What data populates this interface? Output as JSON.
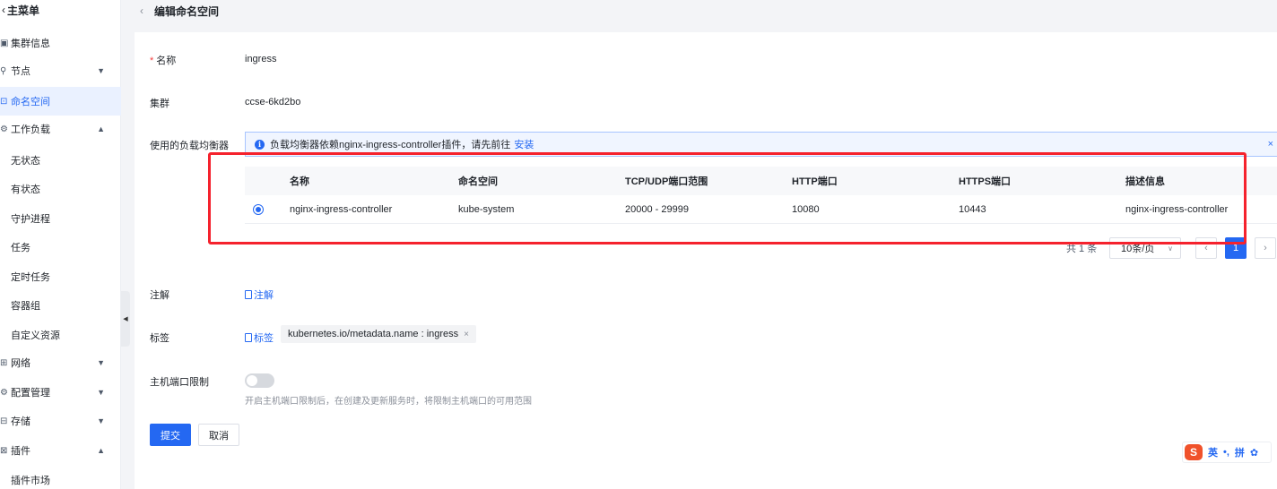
{
  "sidebar": {
    "back_label": "主菜单",
    "items": [
      {
        "label": "集群信息",
        "icon": "cluster-icon"
      },
      {
        "label": "节点",
        "icon": "node-icon",
        "chevron": "▼"
      },
      {
        "label": "命名空间",
        "icon": "namespace-icon",
        "active": true
      },
      {
        "label": "工作负载",
        "icon": "workload-icon",
        "chevron": "▲"
      },
      {
        "label": "无状态"
      },
      {
        "label": "有状态"
      },
      {
        "label": "守护进程"
      },
      {
        "label": "任务"
      },
      {
        "label": "定时任务"
      },
      {
        "label": "容器组"
      },
      {
        "label": "自定义资源"
      },
      {
        "label": "网络",
        "icon": "network-icon",
        "chevron": "▼"
      },
      {
        "label": "配置管理",
        "icon": "config-icon",
        "chevron": "▼"
      },
      {
        "label": "存储",
        "icon": "storage-icon",
        "chevron": "▼"
      },
      {
        "label": "插件",
        "icon": "plugin-icon",
        "chevron": "▲"
      },
      {
        "label": "插件市场"
      }
    ]
  },
  "header": {
    "title": "编辑命名空间"
  },
  "form": {
    "name_label": "名称",
    "name_value": "ingress",
    "cluster_label": "集群",
    "cluster_value": "ccse-6kd2bo",
    "lb_label": "使用的负载均衡器",
    "banner_text": "负载均衡器依赖nginx-ingress-controller插件，请先前往",
    "banner_link": "安装",
    "annotation_label": "注解",
    "annotation_link": "注解",
    "tag_label": "标签",
    "tag_link": "标签",
    "tag_value": "kubernetes.io/metadata.name : ingress",
    "port_limit_label": "主机端口限制",
    "port_limit_help": "开启主机端口限制后，在创建及更新服务时，将限制主机端口的可用范围",
    "submit_label": "提交",
    "cancel_label": "取消"
  },
  "table": {
    "columns": [
      "名称",
      "命名空间",
      "TCP/UDP端口范围",
      "HTTP端口",
      "HTTPS端口",
      "描述信息"
    ],
    "rows": [
      [
        "nginx-ingress-controller",
        "kube-system",
        "20000 - 29999",
        "10080",
        "10443",
        "nginx-ingress-controller"
      ]
    ]
  },
  "pagination": {
    "total": "共 1 条",
    "page_size": "10条/页",
    "prev": "‹",
    "current": "1",
    "next": "›"
  },
  "ime": {
    "logo": "S",
    "lang": "英",
    "punct": "•,",
    "pinyin": "拼"
  }
}
